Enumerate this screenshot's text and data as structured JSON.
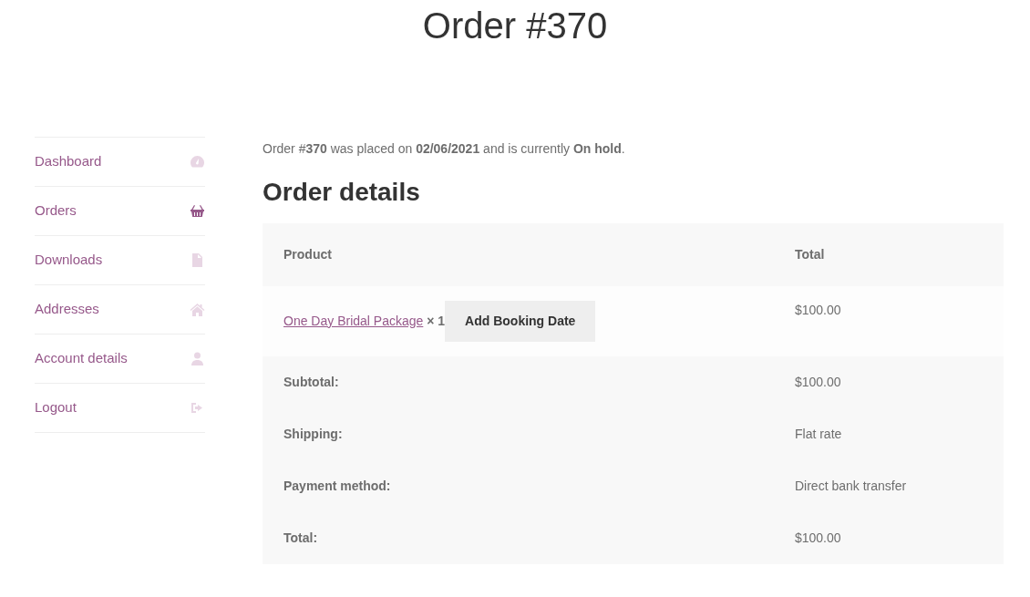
{
  "page_title": "Order #370",
  "nav": [
    {
      "label": "Dashboard",
      "selected": false
    },
    {
      "label": "Orders",
      "selected": true
    },
    {
      "label": "Downloads",
      "selected": false
    },
    {
      "label": "Addresses",
      "selected": false
    },
    {
      "label": "Account details",
      "selected": false
    },
    {
      "label": "Logout",
      "selected": false
    }
  ],
  "summary": "Order #**370** was placed on **02/06/2021** and is currently **On hold**.",
  "details_heading": "Order details",
  "table": {
    "columns": [
      "Product",
      "Total"
    ],
    "items": [
      {
        "product": "One Day Bridal Package",
        "quantity": "× 1",
        "button": "Add Booking Date",
        "total": "$100.00"
      }
    ],
    "totals": [
      {
        "label": "Subtotal:",
        "value": "$100.00"
      },
      {
        "label": "Shipping:",
        "value": "Flat rate"
      },
      {
        "label": "Payment method:",
        "value": "Direct bank transfer"
      },
      {
        "label": "Total:",
        "value": "$100.00"
      }
    ]
  }
}
